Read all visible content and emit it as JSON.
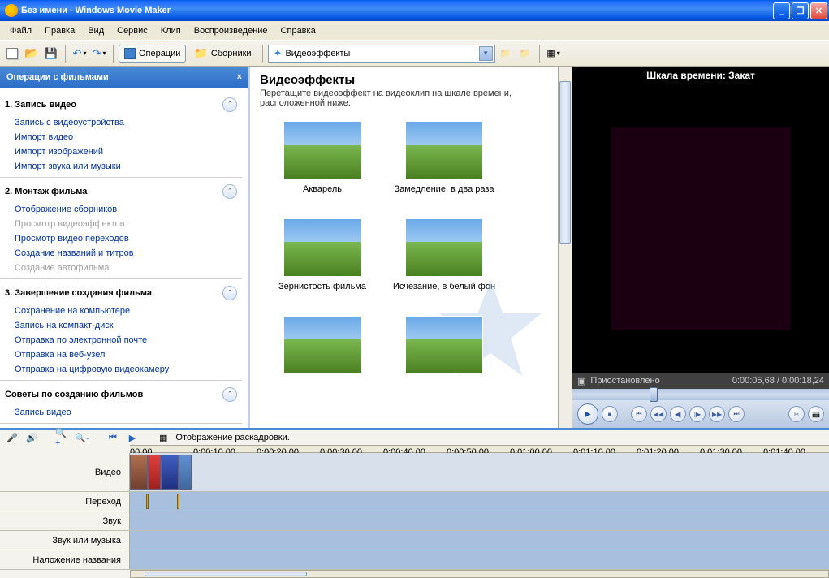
{
  "window": {
    "title": "Без имени - Windows Movie Maker"
  },
  "menu": {
    "items": [
      "Файл",
      "Правка",
      "Вид",
      "Сервис",
      "Клип",
      "Воспроизведение",
      "Справка"
    ]
  },
  "toolbar": {
    "tasks_label": "Операции",
    "collections_label": "Сборники",
    "dropdown_value": "Видеоэффекты"
  },
  "tasks": {
    "header": "Операции с фильмами",
    "sections": [
      {
        "title": "1. Запись видео",
        "links": [
          "Запись с видеоустройства",
          "Импорт видео",
          "Импорт изображений",
          "Импорт звука или музыки"
        ]
      },
      {
        "title": "2. Монтаж фильма",
        "links": [
          "Отображение сборников",
          "Просмотр видеоэффектов",
          "Просмотр видео переходов",
          "Создание названий и титров",
          "Создание автофильма"
        ],
        "disabled": [
          1,
          4
        ]
      },
      {
        "title": "3. Завершение создания фильма",
        "links": [
          "Сохранение на компьютере",
          "Запись на компакт-диск",
          "Отправка по электронной почте",
          "Отправка на веб-узел",
          "Отправка на цифровую видеокамеру"
        ]
      },
      {
        "title": "Советы по созданию фильмов",
        "links": [
          "Запись видео"
        ]
      }
    ]
  },
  "effects": {
    "title": "Видеоэффекты",
    "subtitle": "Перетащите видеоэффект на видеоклип на шкале времени, расположенной ниже.",
    "items": [
      "Акварель",
      "Замедление, в два раза",
      "Зернистость фильма",
      "Исчезание, в белый фон",
      "",
      ""
    ]
  },
  "preview": {
    "title": "Шкала времени: Закат",
    "status": "Приостановлено",
    "time_current": "0:00:05,68",
    "time_total": "0:00:18,24"
  },
  "timeline": {
    "storyboard_label": "Отображение раскадровки.",
    "tracks": [
      "Видео",
      "Переход",
      "Звук",
      "Звук или музыка",
      "Наложение названия"
    ],
    "ticks": [
      "00,00",
      "0:00:10,00",
      "0:00:20,00",
      "0:00:30,00",
      "0:00:40,00",
      "0:00:50,00",
      "0:01:00,00",
      "0:01:10,00",
      "0:01:20,00",
      "0:01:30,00",
      "0:01:40,00"
    ]
  }
}
